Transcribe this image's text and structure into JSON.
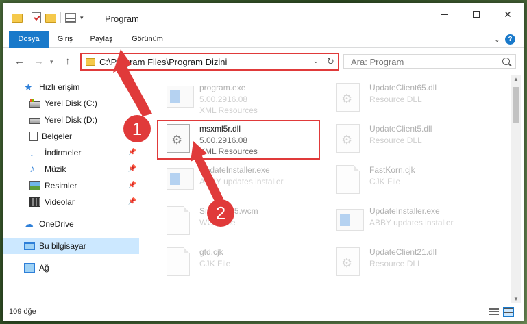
{
  "window": {
    "title": "Program"
  },
  "ribbon": {
    "tabs": [
      {
        "label": "Dosya"
      },
      {
        "label": "Giriş"
      },
      {
        "label": "Paylaş"
      },
      {
        "label": "Görünüm"
      }
    ],
    "help": "?"
  },
  "address": {
    "path": "C:\\Program Files\\Program Dizini"
  },
  "search": {
    "placeholder": "Ara: Program"
  },
  "sidebar": {
    "items": [
      {
        "label": "Hızlı erişim"
      },
      {
        "label": "Yerel Disk (C:)"
      },
      {
        "label": "Yerel Disk (D:)"
      },
      {
        "label": "Belgeler"
      },
      {
        "label": "İndirmeler"
      },
      {
        "label": "Müzik"
      },
      {
        "label": "Resimler"
      },
      {
        "label": "Videolar"
      },
      {
        "label": "OneDrive"
      },
      {
        "label": "Bu bilgisayar"
      },
      {
        "label": "Ağ"
      }
    ]
  },
  "files": [
    {
      "name": "program.exe",
      "line1": "5.00.2916.08",
      "line2": "XML Resources",
      "icon": "exe-icon"
    },
    {
      "name": "UpdateClient65.dll",
      "line1": "Resource DLL",
      "line2": "",
      "icon": "dll-icon"
    },
    {
      "name": "msxml5r.dll",
      "line1": "5.00.2916.08",
      "line2": "XML Resources",
      "icon": "dll-icon"
    },
    {
      "name": "UpdateClient5.dll",
      "line1": "Resource DLL",
      "line2": "",
      "icon": "dll-icon"
    },
    {
      "name": "UpdateInstaller.exe",
      "line1": "ABBY updates installer",
      "line2": "",
      "icon": "exe-icon"
    },
    {
      "name": "FastKorn.cjk",
      "line1": "CJK File",
      "line2": "",
      "icon": "cjk-file-icon"
    },
    {
      "name": "SndTrack5.wcm",
      "line1": "WCM File",
      "line2": "",
      "icon": "file-icon"
    },
    {
      "name": "UpdateInstaller.exe",
      "line1": "ABBY updates installer",
      "line2": "",
      "icon": "exe-icon"
    },
    {
      "name": "gtd.cjk",
      "line1": "CJK File",
      "line2": "",
      "icon": "cjk-file-icon"
    },
    {
      "name": "UpdateClient21.dll",
      "line1": "Resource DLL",
      "line2": "",
      "icon": "dll-icon"
    }
  ],
  "status": {
    "count": "109 öğe"
  },
  "callouts": [
    "1",
    "2"
  ],
  "colors": {
    "accent": "#1979ca",
    "highlight": "#e03a3a",
    "selected": "#cce8ff"
  }
}
